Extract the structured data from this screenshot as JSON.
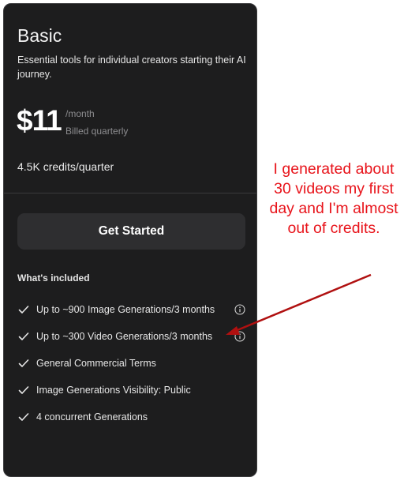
{
  "plan": {
    "name": "Basic",
    "description": "Essential tools for individual creators starting their AI journey.",
    "price": "$11",
    "period": "/month",
    "billing": "Billed quarterly",
    "credits": "4.5K credits/quarter",
    "cta_label": "Get Started",
    "included_heading": "What's included",
    "features": [
      {
        "label": "Up to ~900 Image Generations/3 months",
        "has_info": true
      },
      {
        "label": "Up to ~300 Video Generations/3 months",
        "has_info": true
      },
      {
        "label": "General Commercial Terms",
        "has_info": false
      },
      {
        "label": "Image Generations Visibility: Public",
        "has_info": false
      },
      {
        "label": "4 concurrent Generations",
        "has_info": false
      }
    ]
  },
  "annotation": {
    "text": "I generated about 30 videos my first day and I'm almost out of credits.",
    "color": "#e8141b"
  },
  "colors": {
    "card_bg": "#1d1d1e",
    "button_bg": "#2e2e30",
    "muted_text": "#8d8d90"
  }
}
